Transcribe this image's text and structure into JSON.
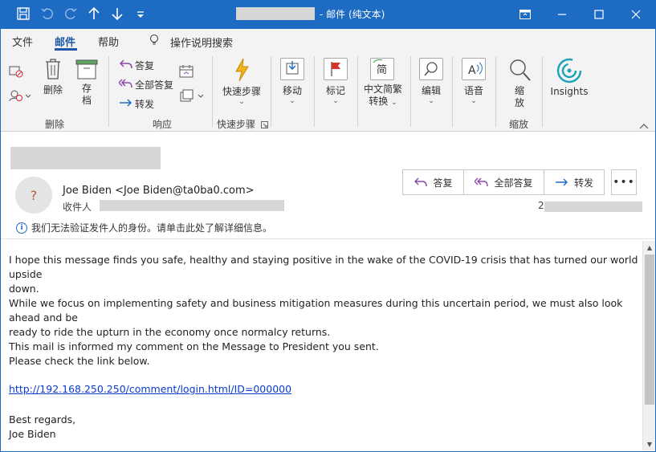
{
  "window": {
    "title": "- 邮件 (纯文本)"
  },
  "menu": {
    "items": [
      "文件",
      "邮件",
      "帮助"
    ],
    "tell_me": "操作说明搜索"
  },
  "ribbon": {
    "delete_group": {
      "delete_label": "删除",
      "archive_label": "存档",
      "group_label": "删除"
    },
    "respond_group": {
      "reply": "答复",
      "reply_all": "全部答复",
      "forward": "转发",
      "group_label": "响应"
    },
    "quick_steps_group": {
      "label": "快速步骤",
      "group_label": "快速步骤"
    },
    "move": "移动",
    "tags": "标记",
    "chinese_conv": "中文简繁转换",
    "chinese_conv_line1": "中文简繁",
    "chinese_conv_line2": "转换",
    "editing": "编辑",
    "speech": "语音",
    "zoom": {
      "label_line1": "缩",
      "label_line2": "放",
      "group_label": "缩放"
    },
    "insights": "Insights"
  },
  "message": {
    "avatar_initial": "?",
    "sender": "Joe Biden <Joe Biden@ta0ba0.com>",
    "to_label": "收件人",
    "date_prefix": "2",
    "warning": "我们无法验证发件人的身份。请单击此处了解详细信息。",
    "actions": {
      "reply": "答复",
      "reply_all": "全部答复",
      "forward": "转发",
      "more": "•••"
    },
    "body": {
      "p1_line1": "I hope this message finds you safe, healthy and staying positive in the wake of the COVID-19 crisis that has turned our world upside",
      "p1_line2": "down.",
      "p2_line1": "While we focus on implementing safety and business mitigation measures during this uncertain period, we must also look ahead and be",
      "p2_line2": "ready to ride the upturn in the economy once normalcy returns.",
      "p3_line1": "This mail is informed my comment on the Message to President  you sent.",
      "p3_line2": "Please check the link below.",
      "link": "http://192.168.250.250/comment/login.html/ID=000000",
      "closing": "Best regards,",
      "signature": "Joe Biden"
    }
  },
  "colors": {
    "titlebar": "#1e6bc4",
    "accent": "#1e5aa8",
    "link": "#0b3ad1",
    "redaction": "#d6d6d6"
  }
}
